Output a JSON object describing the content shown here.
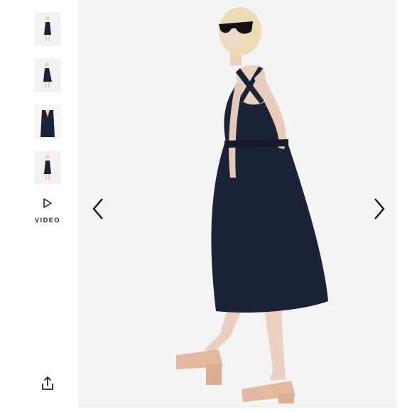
{
  "gallery": {
    "thumbnails": [
      {
        "alt": "thumbnail-1"
      },
      {
        "alt": "thumbnail-2"
      },
      {
        "alt": "thumbnail-3"
      },
      {
        "alt": "thumbnail-4"
      }
    ],
    "video_label": "VIDEO",
    "icons": {
      "video": "play-outline-icon",
      "share": "share-icon",
      "prev": "chevron-left-icon",
      "next": "chevron-right-icon"
    },
    "colors": {
      "dress": "#1c2237",
      "stage_bg": "#f4f4f4",
      "skin": "#ead1c0",
      "hair": "#ecdcb6",
      "sandal": "#e0b69e"
    }
  }
}
